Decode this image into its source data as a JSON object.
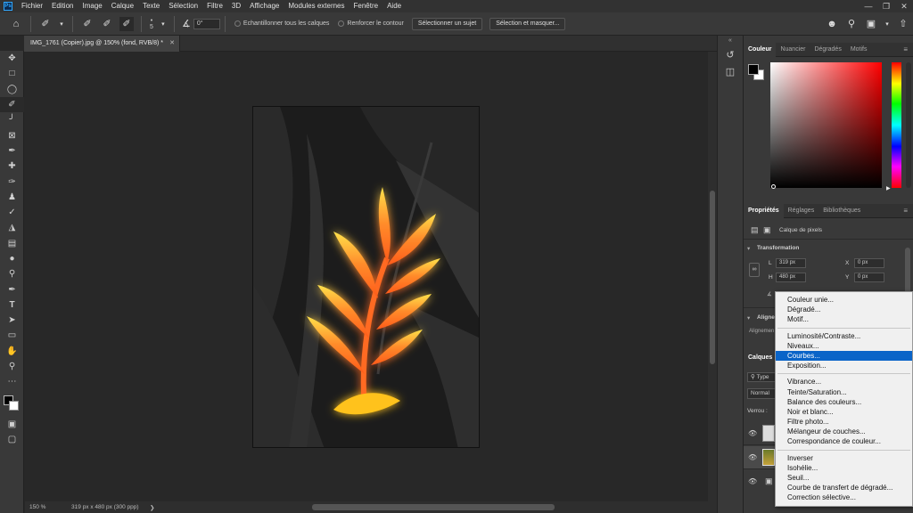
{
  "menubar": {
    "items": [
      "Fichier",
      "Edition",
      "Image",
      "Calque",
      "Texte",
      "Sélection",
      "Filtre",
      "3D",
      "Affichage",
      "Modules externes",
      "Fenêtre",
      "Aide"
    ]
  },
  "options": {
    "size_value": "5",
    "angle_value": "0°",
    "sample_all_label": "Echantillonner tous les calques",
    "enhance_edge_label": "Renforcer le contour",
    "select_subject_label": "Sélectionner un sujet",
    "select_mask_label": "Sélection et masquer..."
  },
  "document": {
    "tab_title": "IMG_1761 (Copier).jpg @ 150% (fond, RVB/8) *",
    "zoom": "150 %",
    "info": "319 px x 480 px (300 ppp)"
  },
  "color_panel": {
    "tabs": [
      "Couleur",
      "Nuancier",
      "Dégradés",
      "Motifs"
    ],
    "hue_accent": "#ff0000"
  },
  "properties_panel": {
    "tabs": [
      "Propriétés",
      "Réglages",
      "Bibliothèques"
    ],
    "layer_kind": "Calque de pixels",
    "transform_title": "Transformation",
    "w_label": "L",
    "w_value": "319 px",
    "h_label": "H",
    "h_value": "480 px",
    "x_label": "X",
    "x_value": "0 px",
    "y_label": "Y",
    "y_value": "0 px",
    "align_title": "Aligne",
    "align_text": "Alignemen"
  },
  "layers_panel": {
    "tab": "Calques",
    "filter_type": "Type",
    "blend_mode": "Normal",
    "lock_label": "Verrou :"
  },
  "context_menu": {
    "groups": [
      [
        "Couleur unie...",
        "Dégradé...",
        "Motif..."
      ],
      [
        "Luminosité/Contraste...",
        "Niveaux...",
        "Courbes...",
        "Exposition..."
      ],
      [
        "Vibrance...",
        "Teinte/Saturation...",
        "Balance des couleurs...",
        "Noir et blanc...",
        "Filtre photo...",
        "Mélangeur de couches...",
        "Correspondance de couleur..."
      ],
      [
        "Inverser",
        "Isohélie...",
        "Seuil...",
        "Courbe de transfert de dégradé...",
        "Correction sélective..."
      ]
    ],
    "highlighted": "Courbes...",
    "highlight_color": "#0a64c8"
  }
}
